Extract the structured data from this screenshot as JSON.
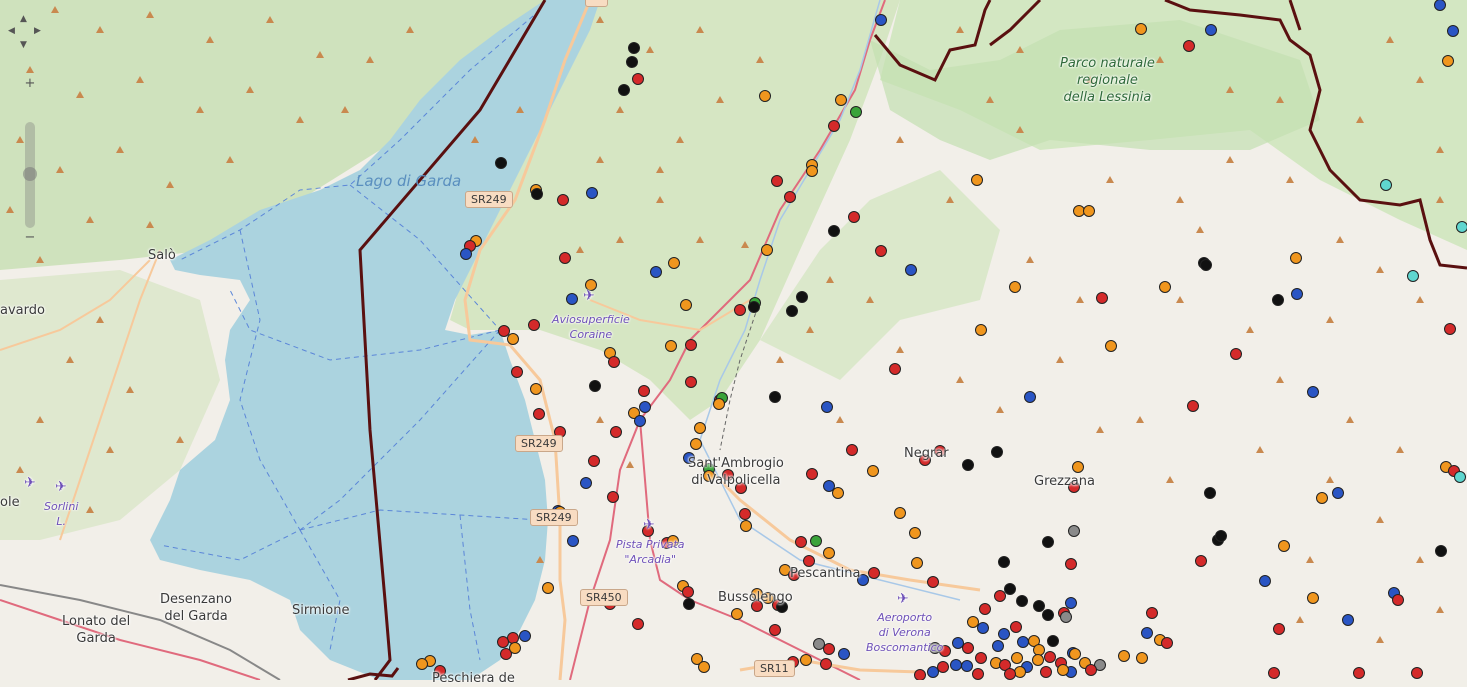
{
  "labels": {
    "lake": "Lago di Garda",
    "park": [
      "Parco naturale",
      "regionale",
      "della Lessinia"
    ],
    "salo": "Salò",
    "gavardo": "avardo",
    "sole": "ole",
    "sorlini": [
      "Sorlini",
      "L."
    ],
    "desenzano": [
      "Desenzano",
      "del Garda"
    ],
    "lonato": [
      "Lonato del",
      "Garda"
    ],
    "sirmione": "Sirmione",
    "aviosuperficie": [
      "Aviosuperficie",
      "Coraine"
    ],
    "santambrogio": [
      "Sant'Ambrogio",
      "di Valpolicella"
    ],
    "pescantina": "Pescantina",
    "bussolengo": "Bussolengo",
    "negrar": "Negrar",
    "grezzana": "Grezzana",
    "pista": [
      "Pista Privata",
      "\"Arcadia\""
    ],
    "aeroporto": [
      "Aeroporto",
      "di Verona",
      "Boscomantico"
    ],
    "peschiera": "Peschiera de"
  },
  "roads": {
    "sr249_a": "SR249",
    "sr249_b": "SR249",
    "sr249_c": "SR249",
    "sr450": "SR450",
    "sr11": "SR11"
  },
  "controls": {
    "zoom_in": "+",
    "zoom_out": "−",
    "pan_up": "▲",
    "pan_down": "▼",
    "pan_left": "◀",
    "pan_right": "▶"
  },
  "marker_colors": {
    "red": "#d42a2a",
    "orange": "#f0961e",
    "blue": "#2a55c4",
    "black": "#111111",
    "green": "#3aa33a",
    "gray": "#8a8a8a",
    "cyan": "#5fd6cf"
  },
  "markers": [
    [
      "black",
      634,
      48
    ],
    [
      "black",
      632,
      62
    ],
    [
      "red",
      638,
      79
    ],
    [
      "black",
      624,
      90
    ],
    [
      "black",
      501,
      163
    ],
    [
      "orange",
      536,
      190
    ],
    [
      "black",
      537,
      194
    ],
    [
      "red",
      563,
      200
    ],
    [
      "blue",
      592,
      193
    ],
    [
      "orange",
      476,
      241
    ],
    [
      "red",
      470,
      246
    ],
    [
      "blue",
      466,
      254
    ],
    [
      "red",
      565,
      258
    ],
    [
      "orange",
      591,
      285
    ],
    [
      "blue",
      572,
      299
    ],
    [
      "blue",
      656,
      272
    ],
    [
      "orange",
      674,
      263
    ],
    [
      "orange",
      686,
      305
    ],
    [
      "red",
      504,
      331
    ],
    [
      "orange",
      513,
      339
    ],
    [
      "red",
      534,
      325
    ],
    [
      "red",
      517,
      372
    ],
    [
      "orange",
      536,
      389
    ],
    [
      "orange",
      610,
      353
    ],
    [
      "red",
      614,
      362
    ],
    [
      "black",
      595,
      386
    ],
    [
      "red",
      644,
      391
    ],
    [
      "blue",
      645,
      407
    ],
    [
      "orange",
      634,
      413
    ],
    [
      "blue",
      640,
      421
    ],
    [
      "red",
      539,
      414
    ],
    [
      "red",
      560,
      432
    ],
    [
      "red",
      616,
      432
    ],
    [
      "orange",
      671,
      346
    ],
    [
      "red",
      691,
      345
    ],
    [
      "red",
      594,
      461
    ],
    [
      "blue",
      586,
      483
    ],
    [
      "red",
      613,
      497
    ],
    [
      "blue",
      558,
      511
    ],
    [
      "orange",
      560,
      512
    ],
    [
      "blue",
      573,
      541
    ],
    [
      "red",
      648,
      531
    ],
    [
      "red",
      667,
      543
    ],
    [
      "orange",
      673,
      541
    ],
    [
      "orange",
      548,
      588
    ],
    [
      "red",
      610,
      604
    ],
    [
      "red",
      638,
      624
    ],
    [
      "red",
      513,
      638
    ],
    [
      "red",
      503,
      642
    ],
    [
      "red",
      506,
      654
    ],
    [
      "orange",
      515,
      648
    ],
    [
      "blue",
      525,
      636
    ],
    [
      "red",
      440,
      671
    ],
    [
      "orange",
      430,
      661
    ],
    [
      "orange",
      422,
      664
    ],
    [
      "orange",
      765,
      96
    ],
    [
      "orange",
      841,
      100
    ],
    [
      "red",
      834,
      126
    ],
    [
      "green",
      856,
      112
    ],
    [
      "blue",
      881,
      20
    ],
    [
      "red",
      777,
      181
    ],
    [
      "orange",
      812,
      165
    ],
    [
      "orange",
      812,
      171
    ],
    [
      "red",
      790,
      197
    ],
    [
      "red",
      854,
      217
    ],
    [
      "black",
      834,
      231
    ],
    [
      "orange",
      767,
      250
    ],
    [
      "red",
      881,
      251
    ],
    [
      "red",
      740,
      310
    ],
    [
      "green",
      755,
      303
    ],
    [
      "black",
      754,
      307
    ],
    [
      "black",
      802,
      297
    ],
    [
      "black",
      792,
      311
    ],
    [
      "red",
      691,
      382
    ],
    [
      "orange",
      700,
      428
    ],
    [
      "orange",
      696,
      444
    ],
    [
      "red",
      720,
      400
    ],
    [
      "green",
      722,
      398
    ],
    [
      "orange",
      719,
      404
    ],
    [
      "black",
      775,
      397
    ],
    [
      "blue",
      827,
      407
    ],
    [
      "red",
      895,
      369
    ],
    [
      "blue",
      911,
      270
    ],
    [
      "blue",
      689,
      458
    ],
    [
      "green",
      709,
      469
    ],
    [
      "orange",
      709,
      476
    ],
    [
      "red",
      728,
      475
    ],
    [
      "red",
      741,
      488
    ],
    [
      "red",
      745,
      514
    ],
    [
      "orange",
      746,
      526
    ],
    [
      "red",
      812,
      474
    ],
    [
      "blue",
      829,
      486
    ],
    [
      "orange",
      838,
      493
    ],
    [
      "red",
      852,
      450
    ],
    [
      "orange",
      873,
      471
    ],
    [
      "orange",
      900,
      513
    ],
    [
      "orange",
      915,
      533
    ],
    [
      "red",
      801,
      542
    ],
    [
      "green",
      816,
      541
    ],
    [
      "orange",
      829,
      553
    ],
    [
      "orange",
      785,
      570
    ],
    [
      "red",
      794,
      575
    ],
    [
      "red",
      809,
      561
    ],
    [
      "blue",
      863,
      580
    ],
    [
      "red",
      874,
      573
    ],
    [
      "orange",
      917,
      563
    ],
    [
      "red",
      933,
      582
    ],
    [
      "orange",
      757,
      594
    ],
    [
      "orange",
      768,
      598
    ],
    [
      "red",
      778,
      605
    ],
    [
      "black",
      782,
      607
    ],
    [
      "red",
      757,
      606
    ],
    [
      "orange",
      737,
      614
    ],
    [
      "orange",
      683,
      586
    ],
    [
      "red",
      688,
      592
    ],
    [
      "black",
      689,
      604
    ],
    [
      "red",
      775,
      630
    ],
    [
      "orange",
      697,
      659
    ],
    [
      "orange",
      704,
      667
    ],
    [
      "gray",
      819,
      644
    ],
    [
      "red",
      829,
      649
    ],
    [
      "blue",
      844,
      654
    ],
    [
      "orange",
      806,
      660
    ],
    [
      "red",
      793,
      662
    ],
    [
      "red",
      826,
      664
    ],
    [
      "red",
      925,
      460
    ],
    [
      "red",
      940,
      451
    ],
    [
      "black",
      968,
      465
    ],
    [
      "black",
      997,
      452
    ],
    [
      "orange",
      977,
      180
    ],
    [
      "orange",
      1079,
      211
    ],
    [
      "orange",
      1089,
      211
    ],
    [
      "orange",
      1015,
      287
    ],
    [
      "orange",
      981,
      330
    ],
    [
      "orange",
      1111,
      346
    ],
    [
      "red",
      1102,
      298
    ],
    [
      "orange",
      1165,
      287
    ],
    [
      "orange",
      1141,
      29
    ],
    [
      "red",
      1189,
      46
    ],
    [
      "blue",
      1211,
      30
    ],
    [
      "blue",
      1030,
      397
    ],
    [
      "orange",
      1078,
      467
    ],
    [
      "red",
      1074,
      487
    ],
    [
      "black",
      1004,
      562
    ],
    [
      "gray",
      1074,
      531
    ],
    [
      "black",
      1048,
      542
    ],
    [
      "red",
      1071,
      564
    ],
    [
      "black",
      1010,
      589
    ],
    [
      "red",
      1000,
      596
    ],
    [
      "black",
      1022,
      601
    ],
    [
      "black",
      1039,
      606
    ],
    [
      "blue",
      1071,
      603
    ],
    [
      "red",
      1064,
      613
    ],
    [
      "black",
      1048,
      615
    ],
    [
      "gray",
      1066,
      617
    ],
    [
      "red",
      985,
      609
    ],
    [
      "orange",
      973,
      622
    ],
    [
      "blue",
      983,
      628
    ],
    [
      "red",
      1016,
      627
    ],
    [
      "black",
      1053,
      641
    ],
    [
      "orange",
      1034,
      641
    ],
    [
      "blue",
      1004,
      634
    ],
    [
      "blue",
      1023,
      642
    ],
    [
      "orange",
      1039,
      650
    ],
    [
      "blue",
      998,
      646
    ],
    [
      "red",
      968,
      648
    ],
    [
      "blue",
      958,
      643
    ],
    [
      "red",
      945,
      651
    ],
    [
      "gray",
      935,
      648
    ],
    [
      "red",
      943,
      667
    ],
    [
      "blue",
      956,
      665
    ],
    [
      "blue",
      967,
      666
    ],
    [
      "red",
      981,
      658
    ],
    [
      "orange",
      996,
      663
    ],
    [
      "red",
      1005,
      665
    ],
    [
      "orange",
      1017,
      658
    ],
    [
      "blue",
      1027,
      667
    ],
    [
      "orange",
      1038,
      660
    ],
    [
      "red",
      1050,
      657
    ],
    [
      "red",
      1061,
      663
    ],
    [
      "blue",
      1073,
      653
    ],
    [
      "orange",
      1085,
      663
    ],
    [
      "gray",
      1100,
      665
    ],
    [
      "red",
      1091,
      670
    ],
    [
      "blue",
      1071,
      672
    ],
    [
      "orange",
      1063,
      670
    ],
    [
      "red",
      1046,
      672
    ],
    [
      "orange",
      1020,
      672
    ],
    [
      "red",
      1010,
      674
    ],
    [
      "blue",
      933,
      672
    ],
    [
      "red",
      920,
      675
    ],
    [
      "red",
      978,
      674
    ],
    [
      "orange",
      1124,
      656
    ],
    [
      "orange",
      1142,
      658
    ],
    [
      "red",
      1152,
      613
    ],
    [
      "blue",
      1147,
      633
    ],
    [
      "orange",
      1160,
      640
    ],
    [
      "red",
      1167,
      643
    ],
    [
      "orange",
      1075,
      654
    ],
    [
      "black",
      1204,
      263
    ],
    [
      "black",
      1206,
      265
    ],
    [
      "orange",
      1296,
      258
    ],
    [
      "black",
      1278,
      300
    ],
    [
      "blue",
      1297,
      294
    ],
    [
      "red",
      1236,
      354
    ],
    [
      "blue",
      1313,
      392
    ],
    [
      "red",
      1193,
      406
    ],
    [
      "black",
      1210,
      493
    ],
    [
      "blue",
      1338,
      493
    ],
    [
      "orange",
      1322,
      498
    ],
    [
      "black",
      1218,
      540
    ],
    [
      "black",
      1221,
      536
    ],
    [
      "orange",
      1284,
      546
    ],
    [
      "red",
      1201,
      561
    ],
    [
      "blue",
      1265,
      581
    ],
    [
      "orange",
      1313,
      598
    ],
    [
      "red",
      1279,
      629
    ],
    [
      "blue",
      1348,
      620
    ],
    [
      "blue",
      1394,
      593
    ],
    [
      "red",
      1398,
      600
    ],
    [
      "red",
      1274,
      673
    ],
    [
      "red",
      1359,
      673
    ],
    [
      "red",
      1417,
      673
    ],
    [
      "cyan",
      1386,
      185
    ],
    [
      "cyan",
      1413,
      276
    ],
    [
      "red",
      1450,
      329
    ],
    [
      "orange",
      1446,
      467
    ],
    [
      "red",
      1454,
      471
    ],
    [
      "cyan",
      1460,
      477
    ],
    [
      "black",
      1441,
      551
    ],
    [
      "orange",
      1448,
      61
    ],
    [
      "blue",
      1453,
      31
    ],
    [
      "blue",
      1440,
      5
    ],
    [
      "cyan",
      1462,
      227
    ]
  ]
}
